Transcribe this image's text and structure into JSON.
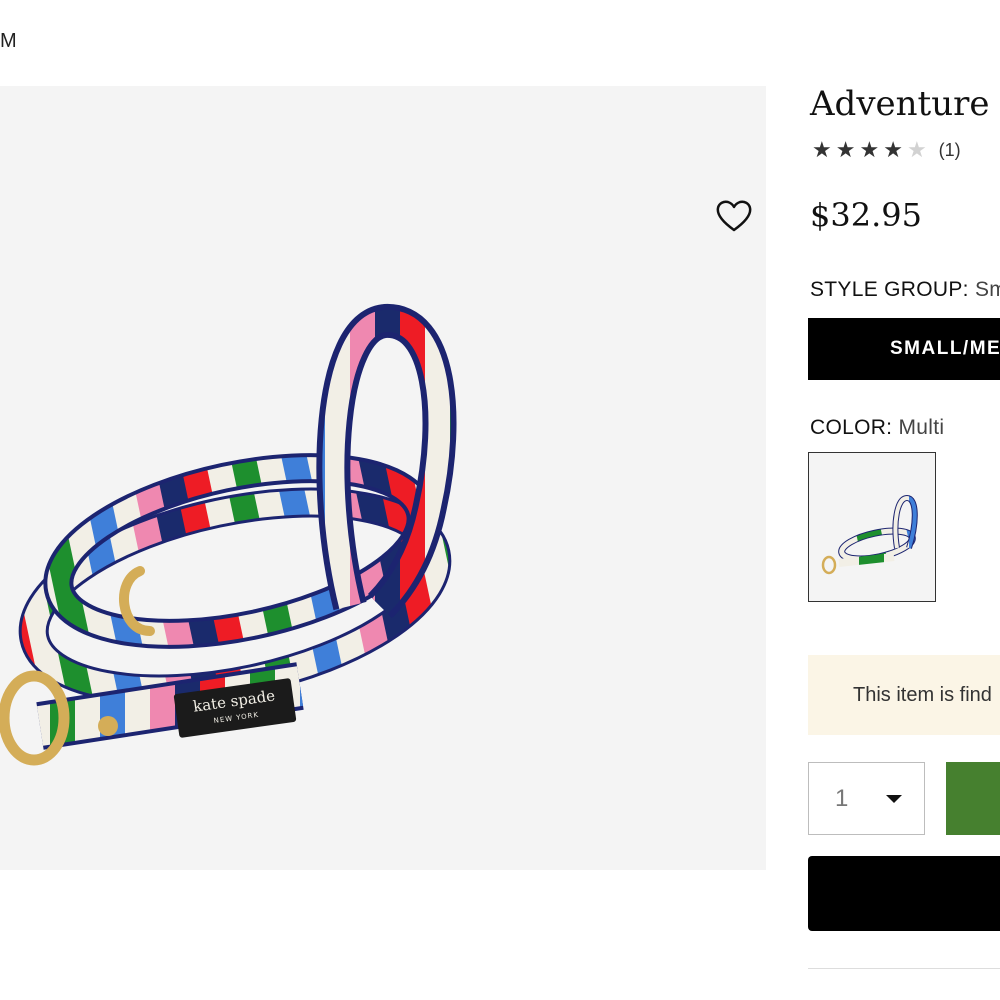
{
  "breadcrumb": {
    "text": "M"
  },
  "product": {
    "title": "Adventure S",
    "rating": {
      "stars_filled": 4,
      "stars_total": 5,
      "review_count": "(1)"
    },
    "price": "$32.95",
    "brand_tag": {
      "line1": "kate spade",
      "line2": "NEW YORK"
    }
  },
  "style_group": {
    "label": "STYLE GROUP:",
    "value": "Sm",
    "selected_button": "SMALL/ME"
  },
  "color": {
    "label": "COLOR:",
    "value": "Multi"
  },
  "notice": {
    "text": "This item is find"
  },
  "quantity": {
    "value": "1"
  },
  "icons": {
    "wishlist": "heart-icon",
    "dropdown": "caret-down-icon"
  },
  "colors": {
    "accent_green": "#46802f",
    "notice_bg": "#fbf5e6",
    "image_bg": "#f4f4f4",
    "primary_button": "#000000"
  }
}
